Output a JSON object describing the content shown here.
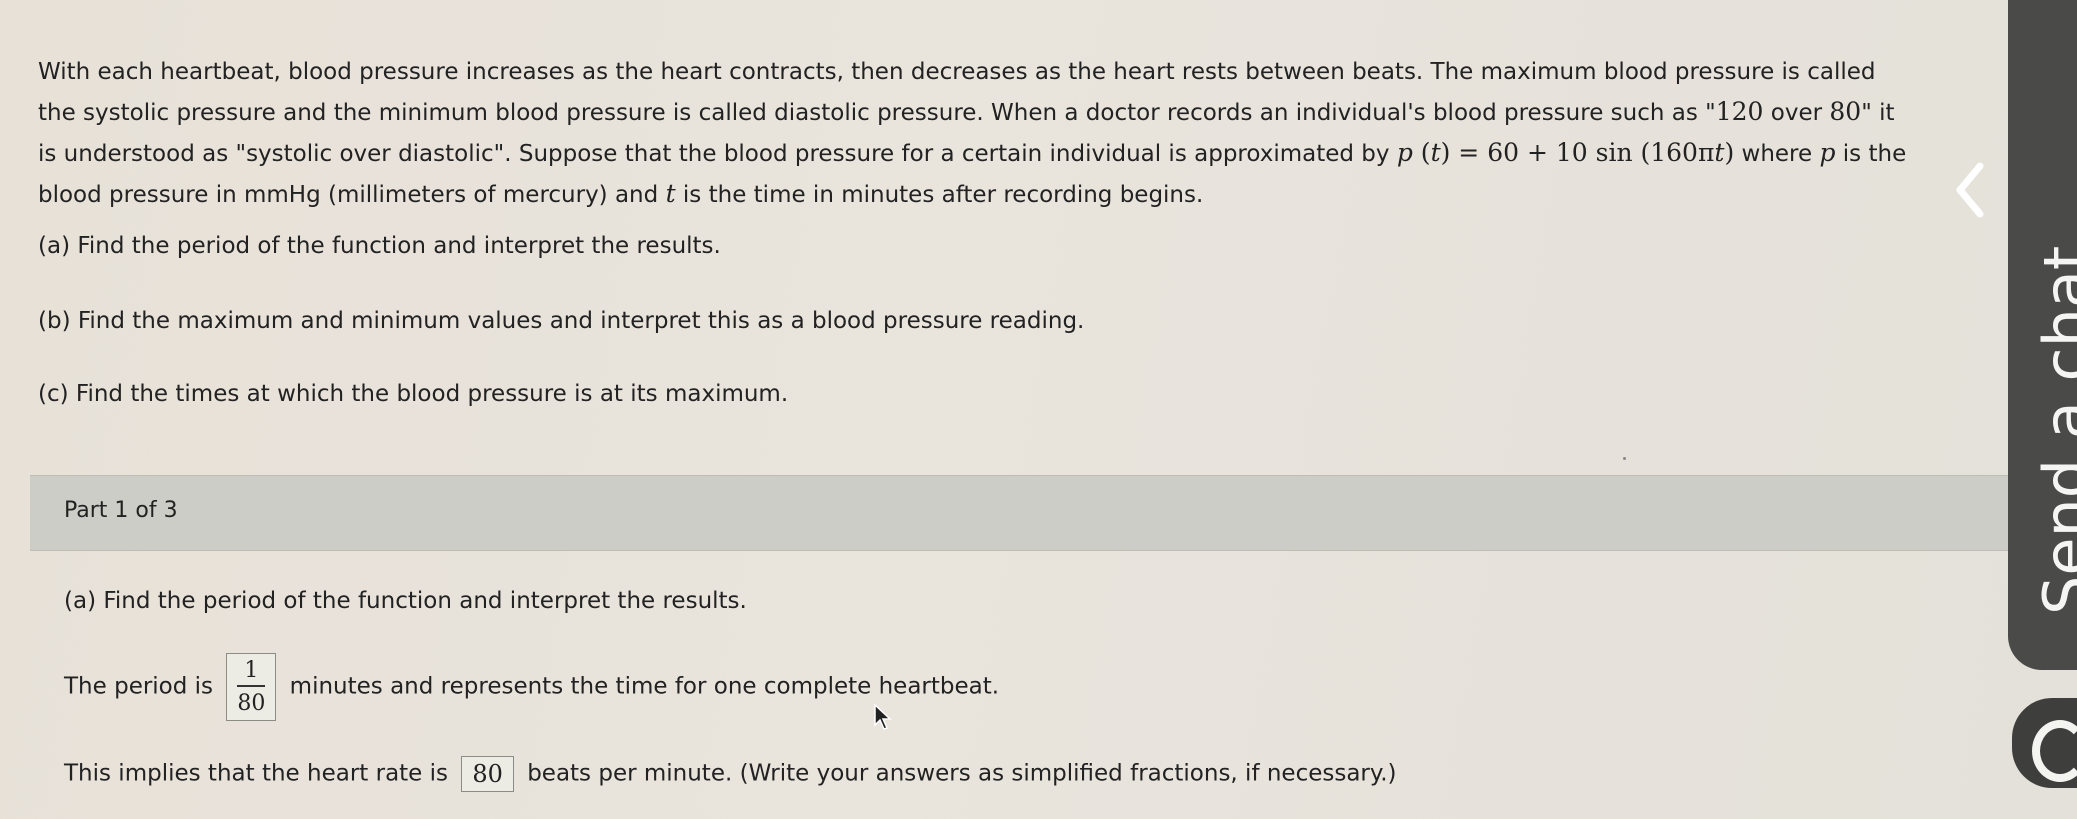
{
  "problem": {
    "line1": "With each heartbeat, blood pressure increases as the heart contracts, then decreases as the heart rests between beats. The maximum blood pressure is called",
    "line2_a": "the systolic pressure and the minimum blood pressure is called diastolic pressure. When a doctor records an individual's blood pressure such as \"",
    "line2_v1": "120",
    "line2_b": " over ",
    "line2_v2": "80",
    "line2_c": "\" it",
    "line3_a": "is understood as \"systolic over diastolic\". Suppose that the blood pressure for a certain individual is approximated by ",
    "formula_p": "p",
    "formula_lparen": " (",
    "formula_t": "t",
    "formula_rest": ") = 60 + 10 sin (160π",
    "formula_t2": "t",
    "formula_end": ")",
    "line3_b": " where ",
    "line3_var": "p",
    "line3_c": " is the",
    "line4_a": "blood pressure in mmHg (millimeters of mercury) and ",
    "line4_var": "t",
    "line4_b": " is the time in minutes after recording begins."
  },
  "questions": {
    "a": "(a) Find the period of the function and interpret the results.",
    "b": "(b) Find the maximum and minimum values and interpret this as a blood pressure reading.",
    "c": "(c) Find the times at which the blood pressure is at its maximum."
  },
  "part": {
    "label": "Part 1 of 3",
    "question": "(a) Find the period of the function and interpret the results."
  },
  "answer": {
    "period_prefix": "The period is",
    "period_num": "1",
    "period_den": "80",
    "period_suffix": "minutes and represents the time for one complete heartbeat.",
    "rate_prefix": "This implies that the heart rate is",
    "rate_value": "80",
    "rate_suffix": "beats per minute. (Write your answers as simplified fractions, if necessary.)"
  },
  "sidebar": {
    "chat_label": "Send a chat"
  },
  "colors": {
    "chat_tab": "#4a4b49",
    "part_bar": "#cdcdc7"
  }
}
